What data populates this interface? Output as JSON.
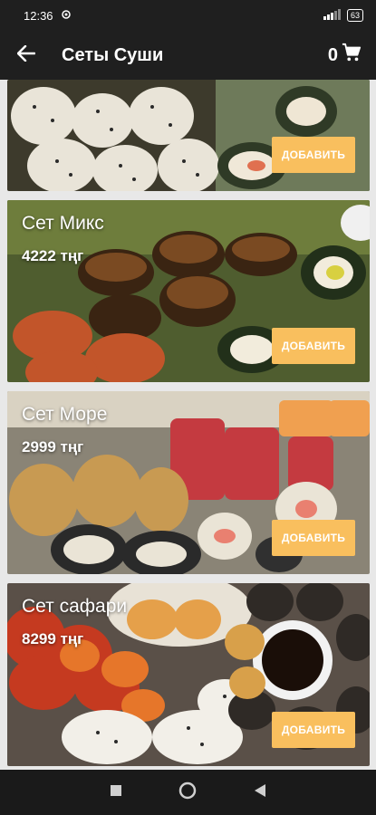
{
  "status": {
    "time": "12:36",
    "battery": "63"
  },
  "appbar": {
    "title": "Сеты Суши",
    "cart_count": "0"
  },
  "cards": [
    {
      "name": "",
      "price": "",
      "button": "ДОБАВИТЬ"
    },
    {
      "name": "Сет Микс",
      "price": "4222 тңг",
      "button": "ДОБАВИТЬ"
    },
    {
      "name": "Сет Море",
      "price": "2999 тңг",
      "button": "ДОБАВИТЬ"
    },
    {
      "name": "Сет сафари",
      "price": "8299 тңг",
      "button": "ДОБАВИТЬ"
    }
  ],
  "colors": {
    "accent": "#f9bf5e",
    "bar": "#1f1f1f"
  }
}
